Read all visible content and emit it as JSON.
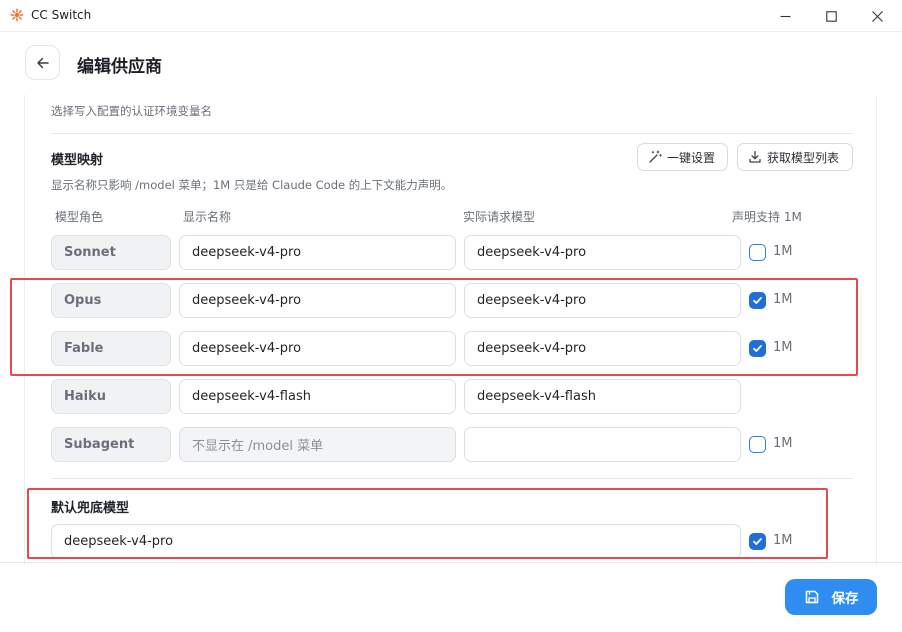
{
  "window": {
    "title": "CC Switch"
  },
  "header": {
    "title": "编辑供应商"
  },
  "auth_hint": "选择写入配置的认证环境变量名",
  "model_mapping": {
    "title": "模型映射",
    "description": "显示名称只影响 /model 菜单；1M 只是给 Claude Code 的上下文能力声明。",
    "one_click_label": "一键设置",
    "fetch_models_label": "获取模型列表",
    "columns": {
      "role": "模型角色",
      "display_name": "显示名称",
      "request_model": "实际请求模型",
      "support_1m": "声明支持 1M"
    },
    "rows": [
      {
        "role": "Sonnet",
        "display": "deepseek-v4-pro",
        "request": "deepseek-v4-pro",
        "has_1m": true,
        "checked": false,
        "label_1m": "1M"
      },
      {
        "role": "Opus",
        "display": "deepseek-v4-pro",
        "request": "deepseek-v4-pro",
        "has_1m": true,
        "checked": true,
        "label_1m": "1M"
      },
      {
        "role": "Fable",
        "display": "deepseek-v4-pro",
        "request": "deepseek-v4-pro",
        "has_1m": true,
        "checked": true,
        "label_1m": "1M"
      },
      {
        "role": "Haiku",
        "display": "deepseek-v4-flash",
        "request": "deepseek-v4-flash",
        "has_1m": false,
        "checked": false,
        "label_1m": ""
      },
      {
        "role": "Subagent",
        "display": "",
        "display_placeholder": "不显示在 /model 菜单",
        "request": "",
        "has_1m": true,
        "checked": false,
        "label_1m": "1M"
      }
    ]
  },
  "default_fallback": {
    "title": "默认兜底模型",
    "value": "deepseek-v4-pro",
    "checked": true,
    "label_1m": "1M"
  },
  "footer": {
    "save_label": "保存"
  },
  "colors": {
    "accent": "#2f8cf0",
    "checkbox_on": "#1f6fd8",
    "annotation": "#e5484d"
  }
}
